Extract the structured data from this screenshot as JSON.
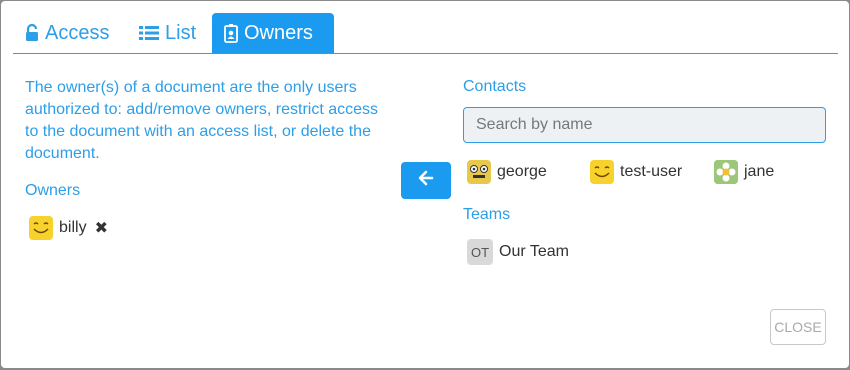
{
  "tabs": [
    {
      "label": "Access",
      "icon": "unlock-icon"
    },
    {
      "label": "List",
      "icon": "list-icon"
    },
    {
      "label": "Owners",
      "icon": "id-badge-icon",
      "active": true
    }
  ],
  "owners_panel": {
    "description": "The owner(s) of a document are the only users authorized to: add/remove owners, restrict access to the document with an access list, or delete the document.",
    "heading": "Owners",
    "owners": [
      {
        "name": "billy",
        "avatar": "smiley-avatar",
        "remove_icon": "close-icon"
      }
    ]
  },
  "contacts_panel": {
    "heading": "Contacts",
    "search_placeholder": "Search by name",
    "contacts": [
      {
        "name": "george",
        "avatar": "robot-avatar"
      },
      {
        "name": "test-user",
        "avatar": "smiley-avatar"
      },
      {
        "name": "jane",
        "avatar": "flower-avatar"
      }
    ],
    "teams_heading": "Teams",
    "teams": [
      {
        "name": "Our Team",
        "initials": "OT"
      }
    ]
  },
  "actions": {
    "add_owner_icon": "arrow-left-icon",
    "close_label": "CLOSE"
  },
  "colors": {
    "accent": "#2d9ee8",
    "active_tab": "#1a9bf0",
    "smiley": "#f7d12c"
  }
}
